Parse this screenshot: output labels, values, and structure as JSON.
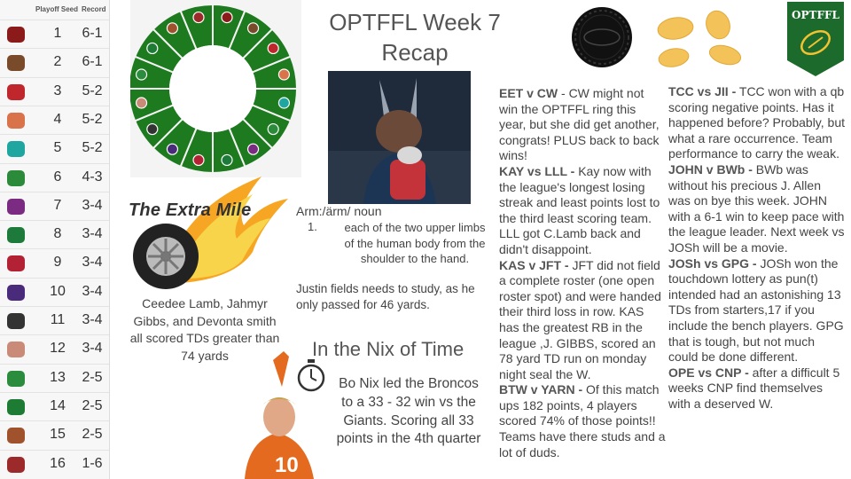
{
  "standings": {
    "header": {
      "seed": "Playoff Seed",
      "record": "Record"
    },
    "rows": [
      {
        "seed": "1",
        "record": "6-1",
        "icon": "pirate-icon",
        "color": "#8b1a1a"
      },
      {
        "seed": "2",
        "record": "6-1",
        "icon": "face-icon",
        "color": "#7a4b2a"
      },
      {
        "seed": "3",
        "record": "5-2",
        "icon": "flag-icon",
        "color": "#c0272d"
      },
      {
        "seed": "4",
        "record": "5-2",
        "icon": "hotdog-icon",
        "color": "#d9734a"
      },
      {
        "seed": "5",
        "record": "5-2",
        "icon": "teal-helmet-icon",
        "color": "#1fa6a0"
      },
      {
        "seed": "6",
        "record": "4-3",
        "icon": "helmet-icon",
        "color": "#2c8a3b"
      },
      {
        "seed": "7",
        "record": "3-4",
        "icon": "helmet-icon",
        "color": "#7b2c82"
      },
      {
        "seed": "8",
        "record": "3-4",
        "icon": "helmet-icon",
        "color": "#1d7a3a"
      },
      {
        "seed": "9",
        "record": "3-4",
        "icon": "helmet-icon",
        "color": "#b22234"
      },
      {
        "seed": "10",
        "record": "3-4",
        "icon": "helmet-icon",
        "color": "#4a2a7a"
      },
      {
        "seed": "11",
        "record": "3-4",
        "icon": "referee-icon",
        "color": "#333333"
      },
      {
        "seed": "12",
        "record": "3-4",
        "icon": "chef-icon",
        "color": "#c98b78"
      },
      {
        "seed": "13",
        "record": "2-5",
        "icon": "player-icon",
        "color": "#2b8c3e"
      },
      {
        "seed": "14",
        "record": "2-5",
        "icon": "jersey-icon",
        "color": "#1e7b34"
      },
      {
        "seed": "15",
        "record": "2-5",
        "icon": "cup-icon",
        "color": "#a0522d"
      },
      {
        "seed": "16",
        "record": "1-6",
        "icon": "helmet-icon",
        "color": "#9c2a2a"
      }
    ]
  },
  "wheel": {
    "color": "#1e7a1e",
    "icon": "team-wheel-icon"
  },
  "title": {
    "line1": "OPTFFL Week 7",
    "line2": "Recap"
  },
  "logo": {
    "text": "OPTFFL",
    "color": "#1d6b2c"
  },
  "extra_mile": {
    "title": "The Extra Mile",
    "text": "Ceedee Lamb, Jahmyr Gibbs, and Devonta smith all scored TDs greater than 74 yards"
  },
  "definition": {
    "head": "Arm:/ärm/ noun",
    "number": "1.",
    "body": "each of the two upper limbs of the human body from the shoulder to the hand.",
    "note": "Justin fields needs to study, as he only passed for 46 yards."
  },
  "nix": {
    "title": "In the Nix of Time",
    "text": "Bo Nix led the Broncos to a 33 - 32 win vs the Giants. Scoring all 33 points in the 4th quarter"
  },
  "recaps_mid": [
    {
      "label": "EET v CW",
      "text": " - CW might not win the OPTFFL ring this year, but she did get another, congrats! PLUS back to back wins!"
    },
    {
      "label": "KAY vs LLL -",
      "text": " Kay now with the league's longest losing streak and least points lost to the third least scoring team. LLL got C.Lamb back and didn't disappoint."
    },
    {
      "label": "KAS v JFT -",
      "text": " JFT did not field a complete roster (one open roster spot) and were handed their third loss in row. KAS has the greatest RB in the league ,J. GIBBS, scored an 78 yard TD run on monday night seal the W."
    },
    {
      "label": "BTW v YARN -",
      "text": " Of this match ups 182 points, 4 players scored 74% of those points!! Teams have there studs and a lot of duds."
    }
  ],
  "recaps_right": [
    {
      "label": "TCC vs JII -",
      "text": " TCC won with a qb scoring negative points. Has it happened before? Probably, but what a rare occurrence. Team performance to carry the weak."
    },
    {
      "label": "JOHN v BWb -",
      "text": " BWb was without his precious J. Allen was on bye this week. JOHN with a 6-1 win to keep pace with the league leader. Next week vs JOSh will be a movie."
    },
    {
      "label": "JOSh vs GPG -",
      "text": " JOSh won the touchdown lottery as pun(t) intended had an astonishing 13 TDs from starters,17 if you include the bench players. GPG that is tough, but not much could be done different."
    },
    {
      "label": "OPE vs CNP -",
      "text": " after a difficult 5 weeks CNP find themselves with a deserved W."
    }
  ]
}
